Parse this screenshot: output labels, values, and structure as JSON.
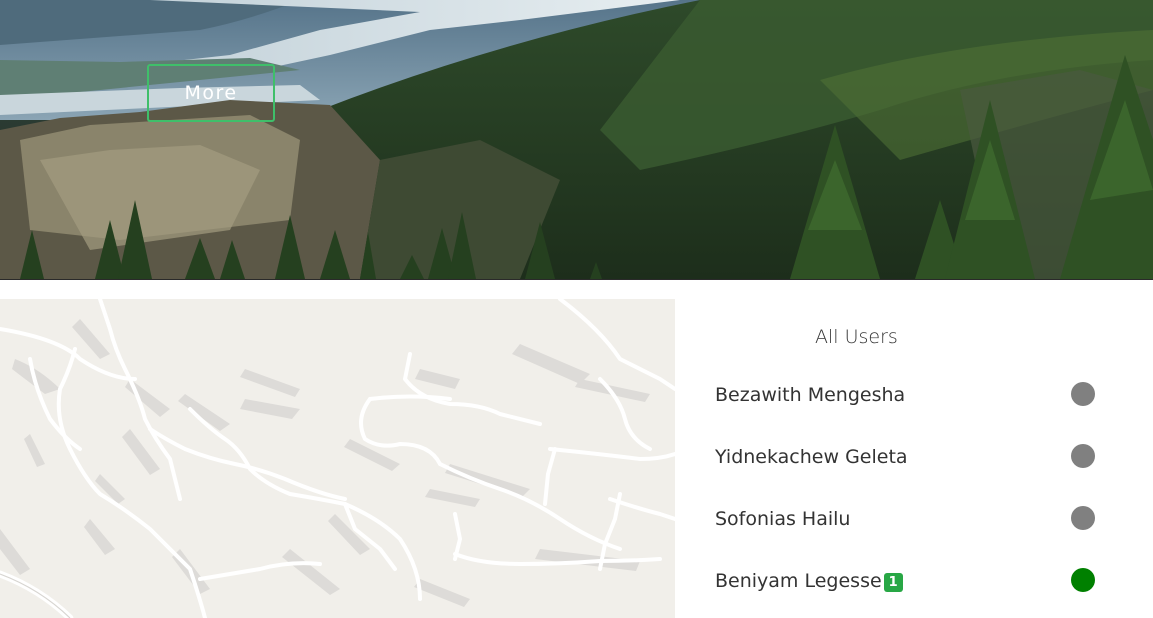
{
  "hero": {
    "more_button_label": "More"
  },
  "users_panel": {
    "title": "All Users",
    "users": [
      {
        "name": "Bezawith Mengesha",
        "status": "offline",
        "badge": ""
      },
      {
        "name": "Yidnekachew Geleta",
        "status": "offline",
        "badge": ""
      },
      {
        "name": "Sofonias Hailu",
        "status": "offline",
        "badge": ""
      },
      {
        "name": "Beniyam Legesse",
        "status": "online",
        "badge": "1"
      }
    ]
  },
  "colors": {
    "online": "#008000",
    "offline": "#808080",
    "badge": "#28a745",
    "button_border": "#3fbf6a",
    "map_background": "#f1efea"
  }
}
